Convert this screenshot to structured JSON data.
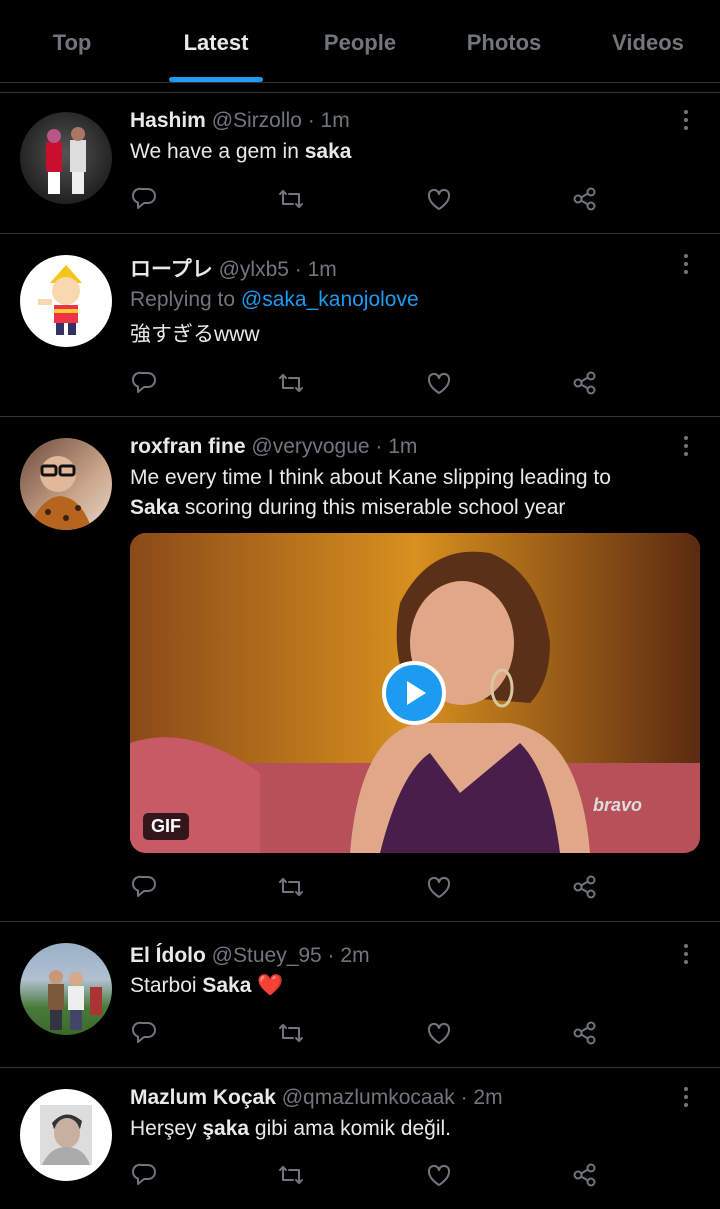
{
  "tabs": [
    {
      "label": "Top"
    },
    {
      "label": "Latest"
    },
    {
      "label": "People"
    },
    {
      "label": "Photos"
    },
    {
      "label": "Videos"
    }
  ],
  "accent_color": "#1d9bf0",
  "tweets": [
    {
      "name": "Hashim",
      "meta": "@Sirzollo · 1m",
      "text": [
        {
          "t": "We have a gem in "
        },
        {
          "b": "saka"
        }
      ]
    },
    {
      "name": "ロープレ",
      "meta": "@ylxb5 · 1m",
      "reply_prefix": "Replying to ",
      "reply_to": "@saka_kanojolove",
      "text": [
        {
          "t": "強すぎるwww"
        }
      ]
    },
    {
      "name": "roxfran fine",
      "meta": "@veryvogue · 1m",
      "text_line1": "Me every time I think about Kane slipping leading to",
      "text_line2": [
        {
          "b": "Saka"
        },
        {
          "t": " scoring during this miserable school year"
        }
      ],
      "media": {
        "badge": "GIF",
        "watermark": "bravo",
        "play_icon": "play-icon"
      }
    },
    {
      "name": "El Ídolo",
      "meta": "@Stuey_95 · 2m",
      "text": [
        {
          "t": "Starboi "
        },
        {
          "b": "Saka"
        },
        {
          "t": " ❤️"
        }
      ]
    },
    {
      "name": "Mazlum Koçak",
      "meta": "@qmazlumkocaak · 2m",
      "text": [
        {
          "t": "Herşey "
        },
        {
          "b": "şaka"
        },
        {
          "t": " gibi ama komik değil."
        }
      ]
    }
  ],
  "icons": [
    "reply-icon",
    "retweet-icon",
    "like-icon",
    "share-icon",
    "more-icon"
  ]
}
